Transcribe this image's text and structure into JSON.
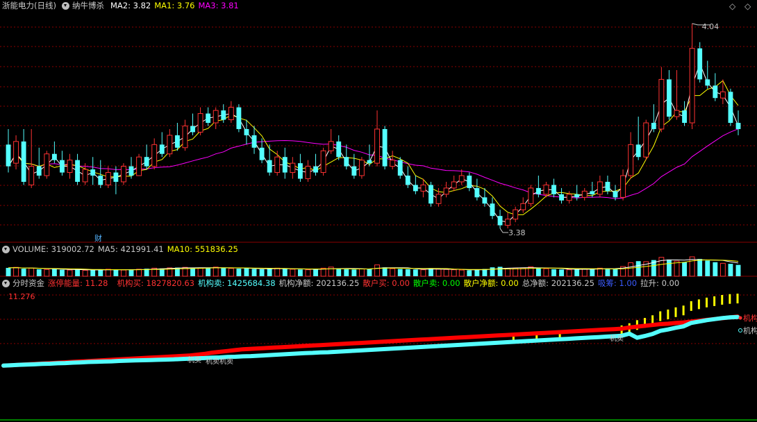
{
  "header": {
    "stock_name": "浙能电力(日线)",
    "indicator_name": "纳牛博杀",
    "ma2": "MA2: 3.82",
    "ma1": "MA1: 3.76",
    "ma3": "MA3: 3.81",
    "high_label": "4.04",
    "low_label": "3.38",
    "cai_marker": "财"
  },
  "volume_panel": {
    "volume": "VOLUME: 319002.72",
    "ma5": "MA5: 421991.41",
    "ma10": "MA10: 551836.25"
  },
  "fund_panel": {
    "title": "分时资金",
    "limit_energy": "涨停能量: 11.28",
    "inst_buy": "机构买: 1827820.63",
    "inst_sell": "机构卖: 1425684.38",
    "inst_net": "机构净额: 202136.25",
    "retail_buy": "散户买: 0.00",
    "retail_sell": "散户卖: 0.00",
    "retail_net": "散户净额: 0.00",
    "total_net": "总净额: 202136.25",
    "suck": "吸筹: 1.00",
    "pull": "拉升: 0.00",
    "scale_value": "11.276",
    "label_inst_buy_end": "机构",
    "label_inst_sell_end": "机构",
    "label_mid": "机卖机卖",
    "label_mid2": "机卖",
    "label_right": "机卖"
  },
  "colors": {
    "up": "#ff3232",
    "down": "#54ffff",
    "ma2": "#ffffff",
    "ma1": "#ffff00",
    "ma3": "#ff00ff",
    "grid": "#8b0000"
  },
  "icons": [
    "chevron-down-icon",
    "chevron-down-icon",
    "chevron-down-icon",
    "diamond-icon",
    "diamond-icon"
  ],
  "chart_data": {
    "type": "candlestick",
    "candles": [
      [
        3.65,
        3.7,
        3.58,
        3.56
      ],
      [
        3.59,
        3.68,
        3.66,
        3.57
      ],
      [
        3.66,
        3.7,
        3.53,
        3.52
      ],
      [
        3.52,
        3.7,
        3.58,
        3.51
      ],
      [
        3.58,
        3.64,
        3.55,
        3.54
      ],
      [
        3.55,
        3.63,
        3.62,
        3.54
      ],
      [
        3.62,
        3.66,
        3.6,
        3.59
      ],
      [
        3.6,
        3.63,
        3.56,
        3.55
      ],
      [
        3.56,
        3.62,
        3.6,
        3.54
      ],
      [
        3.6,
        3.62,
        3.53,
        3.52
      ],
      [
        3.53,
        3.59,
        3.57,
        3.52
      ],
      [
        3.57,
        3.61,
        3.55,
        3.52
      ],
      [
        3.55,
        3.6,
        3.52,
        3.51
      ],
      [
        3.52,
        3.58,
        3.56,
        3.51
      ],
      [
        3.56,
        3.58,
        3.53,
        3.49
      ],
      [
        3.53,
        3.59,
        3.58,
        3.52
      ],
      [
        3.58,
        3.61,
        3.55,
        3.54
      ],
      [
        3.55,
        3.62,
        3.61,
        3.55
      ],
      [
        3.61,
        3.65,
        3.58,
        3.57
      ],
      [
        3.58,
        3.67,
        3.65,
        3.57
      ],
      [
        3.65,
        3.69,
        3.62,
        3.61
      ],
      [
        3.62,
        3.7,
        3.68,
        3.61
      ],
      [
        3.68,
        3.72,
        3.64,
        3.63
      ],
      [
        3.64,
        3.73,
        3.71,
        3.63
      ],
      [
        3.71,
        3.75,
        3.69,
        3.68
      ],
      [
        3.69,
        3.77,
        3.75,
        3.68
      ],
      [
        3.75,
        3.77,
        3.72,
        3.71
      ],
      [
        3.72,
        3.77,
        3.76,
        3.7
      ],
      [
        3.76,
        3.78,
        3.73,
        3.72
      ],
      [
        3.73,
        3.79,
        3.77,
        3.72
      ],
      [
        3.77,
        3.78,
        3.7,
        3.69
      ],
      [
        3.7,
        3.73,
        3.68,
        3.65
      ],
      [
        3.68,
        3.71,
        3.64,
        3.62
      ],
      [
        3.64,
        3.67,
        3.6,
        3.59
      ],
      [
        3.6,
        3.65,
        3.56,
        3.55
      ],
      [
        3.56,
        3.63,
        3.61,
        3.55
      ],
      [
        3.61,
        3.64,
        3.56,
        3.54
      ],
      [
        3.56,
        3.61,
        3.59,
        3.54
      ],
      [
        3.59,
        3.62,
        3.54,
        3.53
      ],
      [
        3.54,
        3.6,
        3.58,
        3.53
      ],
      [
        3.58,
        3.62,
        3.56,
        3.55
      ],
      [
        3.56,
        3.64,
        3.63,
        3.55
      ],
      [
        3.63,
        3.7,
        3.66,
        3.62
      ],
      [
        3.66,
        3.68,
        3.61,
        3.6
      ],
      [
        3.61,
        3.65,
        3.58,
        3.57
      ],
      [
        3.58,
        3.62,
        3.55,
        3.54
      ],
      [
        3.55,
        3.61,
        3.6,
        3.54
      ],
      [
        3.6,
        3.65,
        3.59,
        3.58
      ],
      [
        3.59,
        3.76,
        3.7,
        3.58
      ],
      [
        3.7,
        3.71,
        3.58,
        3.57
      ],
      [
        3.58,
        3.63,
        3.6,
        3.57
      ],
      [
        3.6,
        3.61,
        3.55,
        3.54
      ],
      [
        3.55,
        3.58,
        3.52,
        3.51
      ],
      [
        3.52,
        3.55,
        3.5,
        3.49
      ],
      [
        3.5,
        3.54,
        3.52,
        3.48
      ],
      [
        3.52,
        3.53,
        3.46,
        3.45
      ],
      [
        3.46,
        3.51,
        3.49,
        3.45
      ],
      [
        3.49,
        3.53,
        3.51,
        3.48
      ],
      [
        3.51,
        3.55,
        3.53,
        3.5
      ],
      [
        3.53,
        3.57,
        3.55,
        3.52
      ],
      [
        3.55,
        3.56,
        3.51,
        3.5
      ],
      [
        3.51,
        3.54,
        3.48,
        3.47
      ],
      [
        3.48,
        3.51,
        3.46,
        3.45
      ],
      [
        3.46,
        3.48,
        3.42,
        3.41
      ],
      [
        3.42,
        3.44,
        3.39,
        3.38
      ],
      [
        3.39,
        3.43,
        3.41,
        3.38
      ],
      [
        3.41,
        3.45,
        3.44,
        3.4
      ],
      [
        3.44,
        3.48,
        3.46,
        3.43
      ],
      [
        3.46,
        3.52,
        3.51,
        3.45
      ],
      [
        3.51,
        3.55,
        3.49,
        3.48
      ],
      [
        3.49,
        3.53,
        3.52,
        3.48
      ],
      [
        3.52,
        3.54,
        3.49,
        3.48
      ],
      [
        3.49,
        3.51,
        3.47,
        3.46
      ],
      [
        3.47,
        3.5,
        3.49,
        3.46
      ],
      [
        3.49,
        3.52,
        3.48,
        3.47
      ],
      [
        3.48,
        3.51,
        3.5,
        3.47
      ],
      [
        3.5,
        3.53,
        3.49,
        3.48
      ],
      [
        3.49,
        3.55,
        3.53,
        3.48
      ],
      [
        3.53,
        3.55,
        3.5,
        3.49
      ],
      [
        3.5,
        3.52,
        3.48,
        3.47
      ],
      [
        3.48,
        3.57,
        3.55,
        3.47
      ],
      [
        3.55,
        3.69,
        3.65,
        3.54
      ],
      [
        3.65,
        3.74,
        3.61,
        3.6
      ],
      [
        3.61,
        3.73,
        3.72,
        3.6
      ],
      [
        3.72,
        3.78,
        3.7,
        3.69
      ],
      [
        3.7,
        3.9,
        3.86,
        3.69
      ],
      [
        3.86,
        3.89,
        3.74,
        3.73
      ],
      [
        3.74,
        3.89,
        3.76,
        3.73
      ],
      [
        3.76,
        3.79,
        3.72,
        3.71
      ],
      [
        3.72,
        4.04,
        3.96,
        3.7
      ],
      [
        3.96,
        3.98,
        3.86,
        3.85
      ],
      [
        3.86,
        3.92,
        3.84,
        3.83
      ],
      [
        3.84,
        3.88,
        3.8,
        3.79
      ],
      [
        3.8,
        3.86,
        3.82,
        3.78
      ],
      [
        3.82,
        3.83,
        3.72,
        3.71
      ],
      [
        3.72,
        3.76,
        3.7,
        3.68
      ]
    ],
    "price_range": [
      3.36,
      4.08
    ],
    "volume": [
      310,
      330,
      280,
      300,
      260,
      250,
      270,
      240,
      230,
      250,
      220,
      230,
      240,
      260,
      250,
      230,
      240,
      260,
      280,
      300,
      290,
      310,
      320,
      330,
      300,
      310,
      320,
      340,
      300,
      290,
      280,
      300,
      270,
      260,
      280,
      300,
      270,
      260,
      250,
      240,
      260,
      300,
      340,
      280,
      260,
      250,
      270,
      280,
      420,
      330,
      280,
      270,
      260,
      250,
      240,
      300,
      260,
      250,
      240,
      230,
      220,
      250,
      270,
      330,
      350,
      290,
      300,
      310,
      350,
      300,
      280,
      260,
      250,
      240,
      260,
      270,
      280,
      300,
      290,
      270,
      360,
      500,
      560,
      540,
      600,
      700,
      620,
      560,
      520,
      720,
      640,
      580,
      520,
      480,
      460,
      420
    ],
    "inst_buy": [
      0.0,
      0.02,
      0.04,
      0.05,
      0.06,
      0.08,
      0.09,
      0.11,
      0.12,
      0.14,
      0.15,
      0.17,
      0.18,
      0.19,
      0.2,
      0.22,
      0.23,
      0.24,
      0.25,
      0.26,
      0.27,
      0.28,
      0.29,
      0.31,
      0.32,
      0.34,
      0.35,
      0.37,
      0.38,
      0.4,
      0.41,
      0.43,
      0.44,
      0.46,
      0.48,
      0.5,
      0.52,
      0.54,
      0.56,
      0.58,
      0.59,
      0.61,
      0.62,
      0.64,
      0.66,
      0.68,
      0.7,
      0.72,
      0.74,
      0.76,
      0.78,
      0.8,
      0.82,
      0.84,
      0.86,
      0.88,
      0.9,
      0.92,
      0.94,
      0.96,
      0.98,
      1.0,
      1.02,
      1.04,
      1.06,
      1.08,
      1.1,
      1.12,
      1.14,
      1.16,
      1.18,
      1.2,
      1.22,
      1.24,
      1.26,
      1.28,
      1.3,
      1.32,
      1.34,
      1.36,
      1.38,
      1.48,
      1.62,
      1.72,
      1.84,
      2.02,
      2.1,
      2.2,
      2.28,
      2.48,
      2.56,
      2.64,
      2.7,
      2.76,
      2.8,
      2.82
    ],
    "inst_sell": [
      0.0,
      0.02,
      0.04,
      0.06,
      0.08,
      0.1,
      0.12,
      0.14,
      0.16,
      0.18,
      0.2,
      0.22,
      0.24,
      0.26,
      0.28,
      0.3,
      0.32,
      0.34,
      0.36,
      0.38,
      0.4,
      0.42,
      0.44,
      0.46,
      0.48,
      0.52,
      0.56,
      0.62,
      0.66,
      0.7,
      0.74,
      0.78,
      0.8,
      0.82,
      0.84,
      0.86,
      0.88,
      0.9,
      0.92,
      0.94,
      0.96,
      0.98,
      1.0,
      1.02,
      1.04,
      1.06,
      1.08,
      1.1,
      1.12,
      1.14,
      1.16,
      1.18,
      1.2,
      1.22,
      1.24,
      1.26,
      1.28,
      1.3,
      1.32,
      1.34,
      1.36,
      1.38,
      1.4,
      1.42,
      1.44,
      1.46,
      1.48,
      1.5,
      1.52,
      1.54,
      1.56,
      1.58,
      1.6,
      1.62,
      1.64,
      1.66,
      1.68,
      1.7,
      1.72,
      1.74,
      1.76,
      1.82,
      1.86,
      1.9,
      1.94,
      1.98,
      2.0,
      2.04,
      2.06,
      2.1,
      2.14,
      2.18,
      2.22,
      2.26,
      2.3,
      2.34
    ],
    "fund_range": [
      -0.1,
      3.2
    ]
  }
}
